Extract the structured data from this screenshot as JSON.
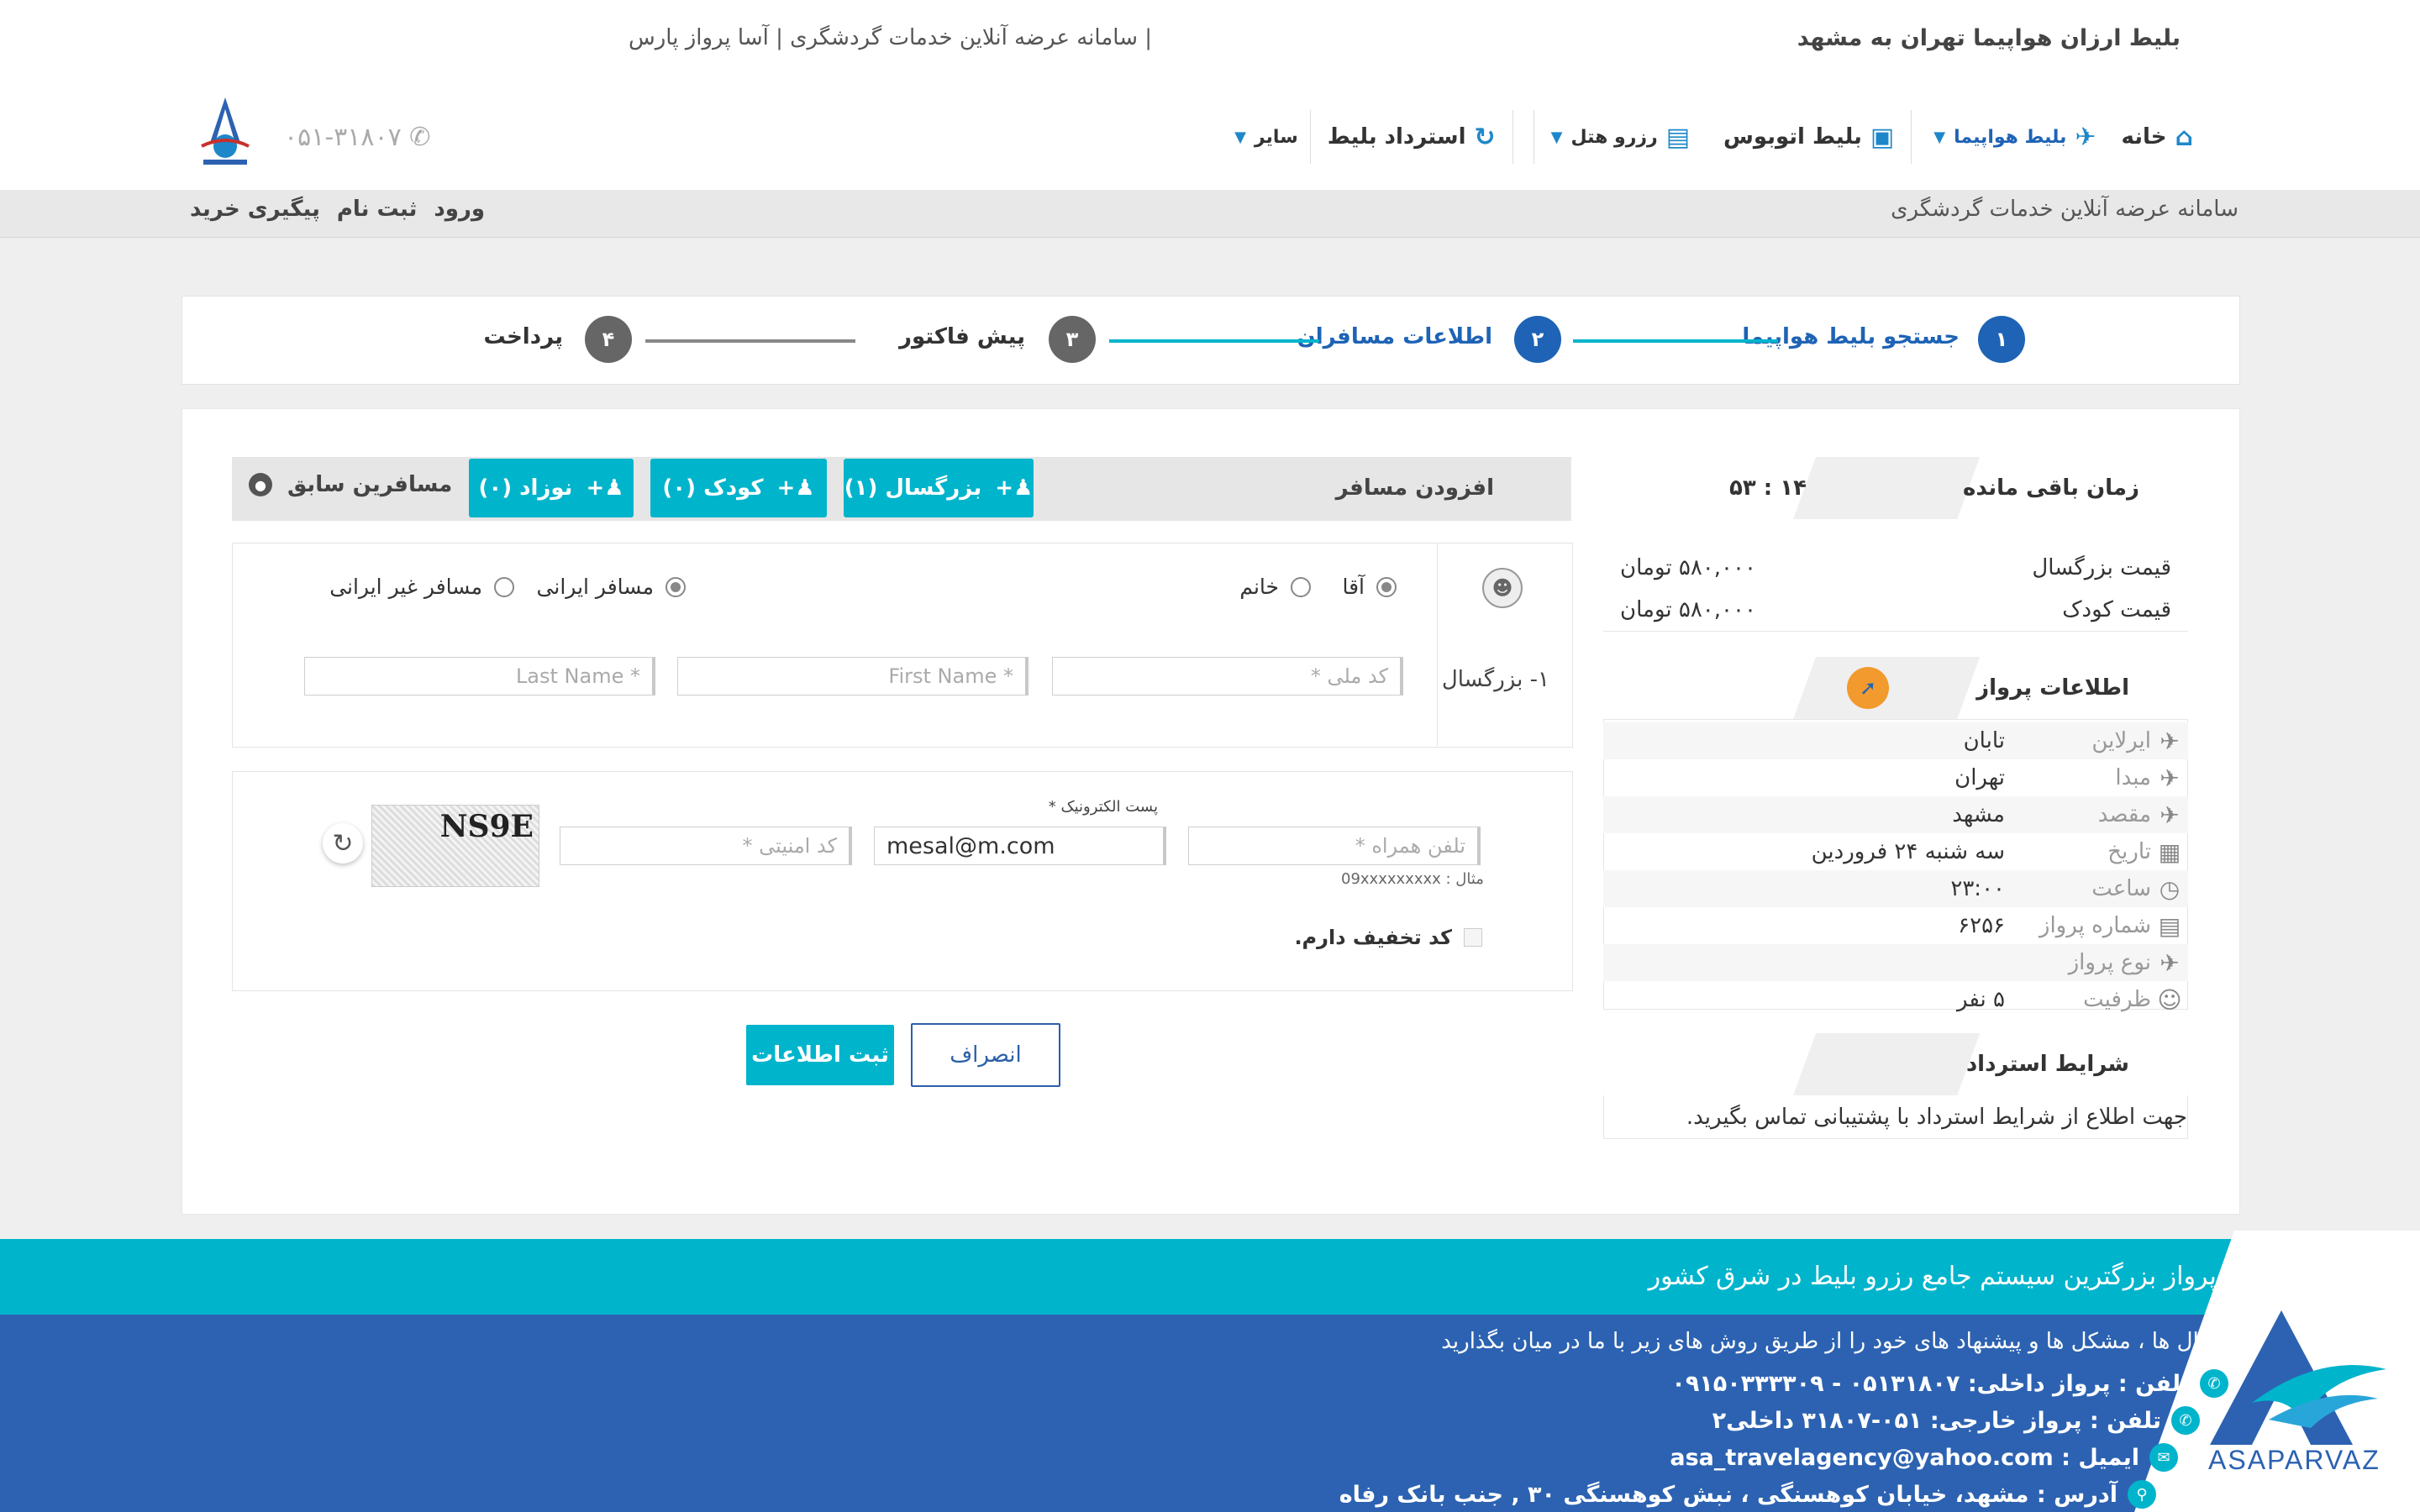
{
  "header": {
    "page_title": "بلیط ارزان هواپیما تهران به مشهد",
    "subtitle": "| سامانه عرضه آنلاین خدمات گردشگری | آسا پرواز پارس",
    "phone": "۰۵۱-۳۱۸۰۷",
    "nav": {
      "home": "خانه",
      "flight": "بلیط هواپیما",
      "bus": "بلیط اتوبوس",
      "hotel": "رزرو هتل",
      "refund": "استرداد بلیط",
      "other": "سایر"
    }
  },
  "subbar": {
    "slogan": "سامانه عرضه آنلاین خدمات گردشگری",
    "login": "ورود",
    "register": "ثبت نام",
    "track": "پیگیری خرید"
  },
  "steps": [
    {
      "num": "۱",
      "label": "جستجو بلیط هواپیما",
      "state": "done"
    },
    {
      "num": "۲",
      "label": "اطلاعات مسافران",
      "state": "active"
    },
    {
      "num": "۳",
      "label": "پیش فاکتور",
      "state": "todo"
    },
    {
      "num": "۴",
      "label": "پرداخت",
      "state": "todo"
    }
  ],
  "timer": {
    "label": "زمان باقی مانده",
    "value": "۱۴ : ۵۳"
  },
  "prices": [
    {
      "label": "قیمت بزرگسال",
      "value": "۵۸۰,۰۰۰ تومان"
    },
    {
      "label": "قیمت کودک",
      "value": "۵۸۰,۰۰۰ تومان"
    }
  ],
  "flight_info": {
    "title": "اطلاعات پرواز",
    "rows": [
      {
        "icon": "plane-icon",
        "label": "ایرلاین",
        "value": "تابان"
      },
      {
        "icon": "takeoff-icon",
        "label": "مبدا",
        "value": "تهران"
      },
      {
        "icon": "landing-icon",
        "label": "مقصد",
        "value": "مشهد"
      },
      {
        "icon": "calendar-icon",
        "label": "تاریخ",
        "value": "سه شنبه ۲۴ فروردین"
      },
      {
        "icon": "clock-icon",
        "label": "ساعت",
        "value": "۲۳:۰۰"
      },
      {
        "icon": "id-card-icon",
        "label": "شماره پرواز",
        "value": "۶۲۵۶"
      },
      {
        "icon": "plane-icon",
        "label": "نوع پرواز",
        "value": ""
      },
      {
        "icon": "people-icon",
        "label": "ظرفیت",
        "value": "۵ نفر"
      }
    ]
  },
  "refund": {
    "title": "شرایط استرداد",
    "text": "جهت اطلاع از شرایط استرداد با پشتیبانی تماس بگیرید."
  },
  "passengers": {
    "add_label": "افزودن مسافر",
    "adult_btn": "بزرگسال (۱)",
    "child_btn": "کودک (۰)",
    "infant_btn": "نوزاد (۰)",
    "previous": "مسافرین سابق",
    "row_label": "۱- بزرگسال",
    "gender_male": "آقا",
    "gender_female": "خانم",
    "iranian": "مسافر ایرانی",
    "foreign": "مسافر غیر ایرانی",
    "national_code_ph": "کد ملی *",
    "first_name_ph": "First Name *",
    "last_name_ph": "Last Name *"
  },
  "contact": {
    "email_label": "پست الکترونیک *",
    "mobile_ph": "تلفن همراه *",
    "mobile_hint": "مثال : 09xxxxxxxxx",
    "email_value": "mesal@m.com",
    "security_ph": "کد امنیتی *",
    "captcha_text": "NS9E",
    "discount_label": "کد تخفیف دارم."
  },
  "actions": {
    "cancel": "انصراف",
    "submit": "ثبت اطلاعات"
  },
  "footer": {
    "title": "آسا پرواز بزرگترین سیستم جامع رزرو بلیط در شرق کشور",
    "intro": "سوال ها ، مشکل ها و پیشنهاد های خود را از طریق روش های زیر با ما در میان بگذارید",
    "phone_domestic": "تلفن : پرواز داخلی: ۰۵۱۳۱۸۰۷ - ۰۹۱۵۰۳۳۳۳۰۹",
    "phone_foreign": "تلفن : پرواز خارجی: ۰۵۱-۳۱۸۰۷ داخلی۲",
    "email": "ایمیل : asa_travelagency@yahoo.com",
    "address": "آدرس : مشهد، خیابان کوهسنگی ، نبش کوهسنگی ۳۰ , جنب بانک رفاه",
    "brand": "ASAPARVAZ"
  },
  "colors": {
    "accent": "#00b4cc",
    "primary": "#2c62b1",
    "step_active": "#1e63b5"
  }
}
